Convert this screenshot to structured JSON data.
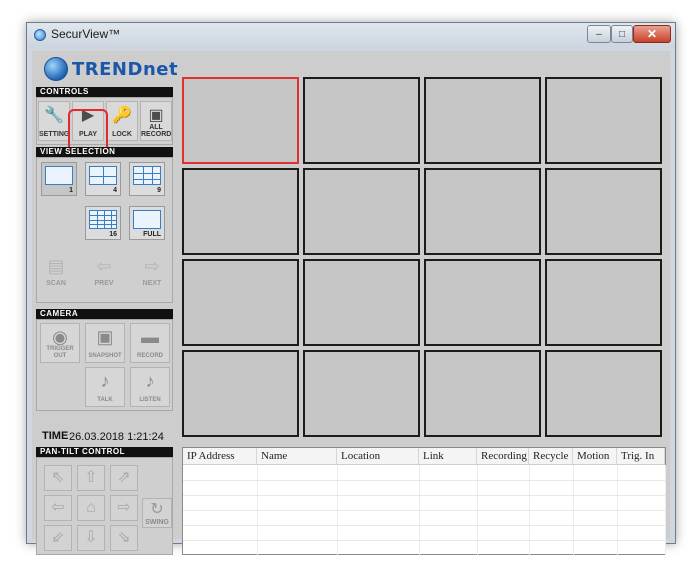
{
  "window": {
    "title": "SecurView™",
    "minimize_glyph": "–",
    "maximize_glyph": "□",
    "close_glyph": "✕"
  },
  "logo": {
    "text": "TRENDnet"
  },
  "controls": {
    "header": "CONTROLS",
    "buttons": [
      {
        "label": "SETTING",
        "icon": "wrench-icon",
        "glyph": "🔧"
      },
      {
        "label": "PLAY",
        "icon": "play-icon",
        "glyph": "▶"
      },
      {
        "label": "LOCK",
        "icon": "key-icon",
        "glyph": "🔑"
      },
      {
        "label": "ALL RECORD",
        "icon": "cameras-icon",
        "glyph": "▣"
      }
    ]
  },
  "view_selection": {
    "header": "VIEW SELECTION",
    "buttons": [
      {
        "num": "1"
      },
      {
        "num": "4"
      },
      {
        "num": "9"
      },
      {
        "num": "16"
      },
      {
        "num": "FULL"
      }
    ],
    "nav": [
      {
        "label": "SCAN",
        "glyph": "▤"
      },
      {
        "label": "PREV",
        "glyph": "⇦"
      },
      {
        "label": "NEXT",
        "glyph": "⇨"
      }
    ]
  },
  "camera": {
    "header": "CAMERA",
    "buttons": [
      {
        "label": "TRIGGER OUT",
        "glyph": "◉"
      },
      {
        "label": "SNAPSHOT",
        "glyph": "▣"
      },
      {
        "label": "RECORD",
        "glyph": "▬"
      },
      {
        "label": "TALK",
        "glyph": "♪"
      },
      {
        "label": "LISTEN",
        "glyph": "♪"
      }
    ]
  },
  "time": {
    "label": "TIME",
    "value": "26.03.2018 1:21:24"
  },
  "pan_tilt": {
    "header": "PAN-TILT CONTROL",
    "arrows": {
      "up_left": "⇖",
      "up": "⇧",
      "up_right": "⇗",
      "left": "⇦",
      "home": "⌂",
      "right": "⇨",
      "down_left": "⇙",
      "down": "⇩",
      "down_right": "⇘"
    },
    "swing_label": "SWING",
    "swing_glyph": "↻"
  },
  "video_grid": {
    "rows": 4,
    "cols": 4,
    "active_cell": 0
  },
  "camera_table": {
    "columns": [
      "IP Address",
      "Name",
      "Location",
      "Link",
      "Recording",
      "Recycle",
      "Motion",
      "Trig. In"
    ],
    "rows": []
  },
  "colors": {
    "active_border": "#e03030",
    "header_bg": "#111111",
    "brand": "#1b57a8"
  }
}
